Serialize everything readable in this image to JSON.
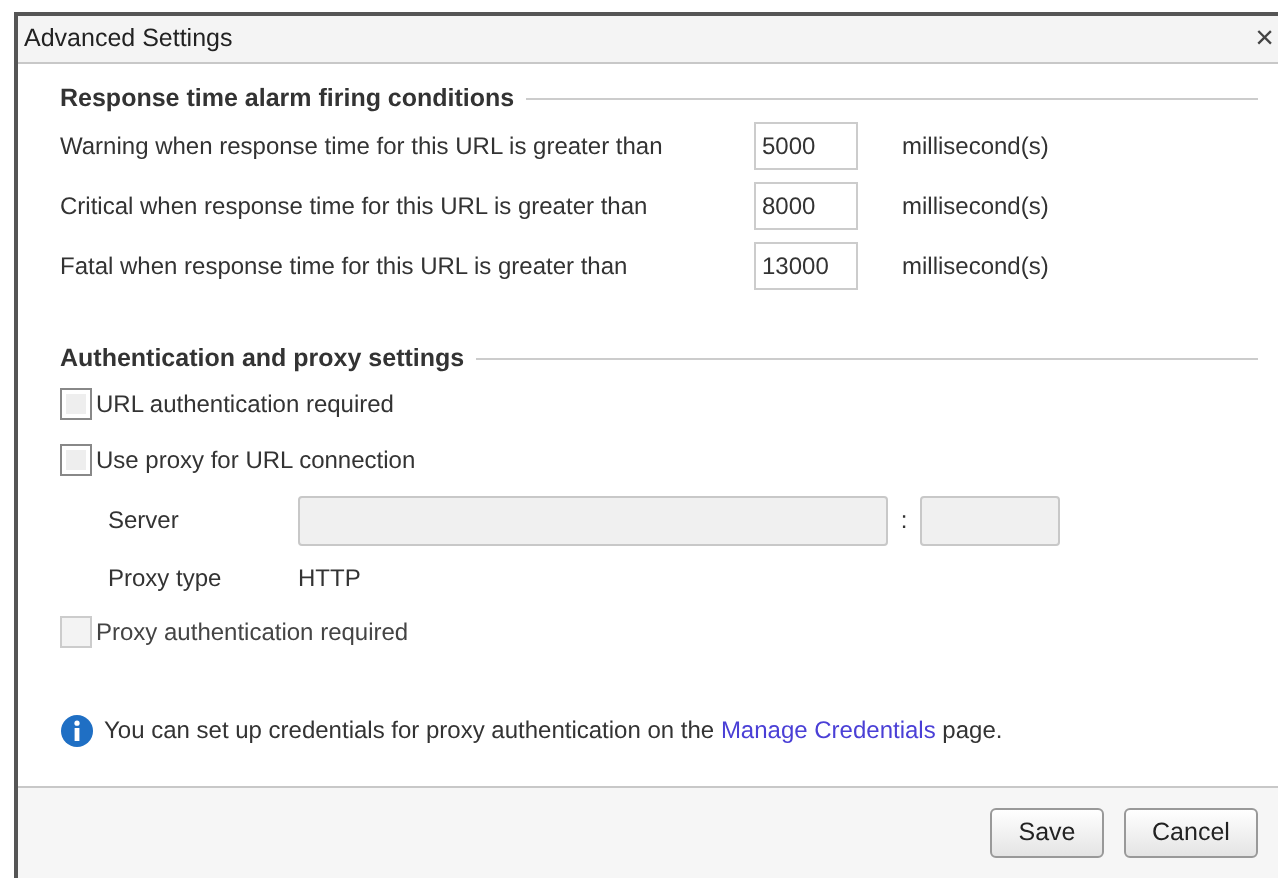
{
  "window": {
    "title": "Advanced Settings",
    "close": "×"
  },
  "alarm_section": {
    "heading": "Response time alarm firing conditions",
    "rows": [
      {
        "label": "Warning when response time for this URL is greater than",
        "value": "5000",
        "unit": "millisecond(s)"
      },
      {
        "label": "Critical when response time for this URL is greater than",
        "value": "8000",
        "unit": "millisecond(s)"
      },
      {
        "label": "Fatal when response time for this URL is greater than",
        "value": "13000",
        "unit": "millisecond(s)"
      }
    ]
  },
  "auth_section": {
    "heading": "Authentication and proxy settings",
    "url_auth": {
      "label": "URL authentication required",
      "checked": false,
      "disabled": false
    },
    "use_proxy": {
      "label": "Use proxy for URL connection",
      "checked": false,
      "disabled": false
    },
    "server": {
      "label": "Server",
      "separator": ":",
      "disabled": true
    },
    "proxy_type": {
      "label": "Proxy type",
      "value": "HTTP"
    },
    "proxy_auth": {
      "label": "Proxy authentication required",
      "checked": false,
      "disabled": true
    }
  },
  "info": {
    "before": "You can set up credentials for proxy authentication on the",
    "link": "Manage Credentials",
    "after": "page."
  },
  "buttons": [
    "Save",
    "Cancel"
  ]
}
